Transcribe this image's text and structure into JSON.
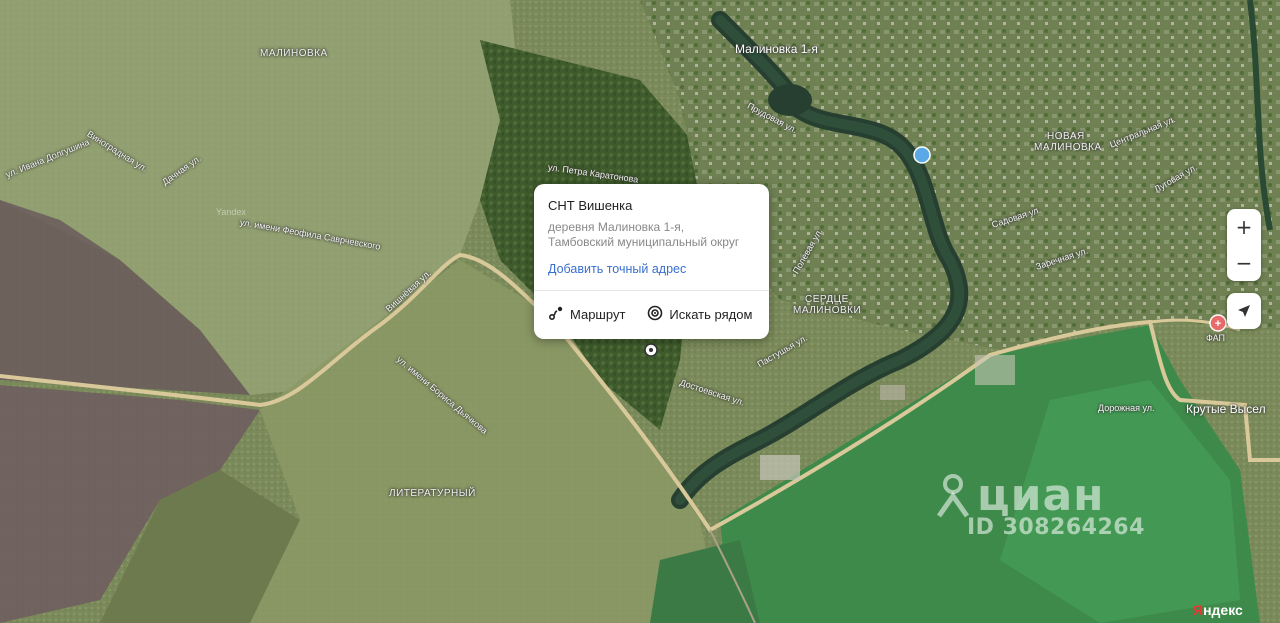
{
  "map": {
    "labels": {
      "malinovka": "МАЛИНОВКА",
      "malinovka_1": "Малиновка 1-я",
      "novaya_malinovka_1": "НОВАЯ",
      "novaya_malinovka_2": "МАЛИНОВКА",
      "serdtse_1": "СЕРДЦЕ",
      "serdtse_2": "МАЛИНОВКИ",
      "literaturny": "ЛИТЕРАТУРНЫЙ",
      "krutye": "Крутые Высел",
      "fap": "ФАП",
      "vinogradnaya": "Виноградная ул.",
      "vishnevaya": "Вишнёвая ул.",
      "petra_karatonova": "ул. Петра Каратонова",
      "ivana_dolgushina": "ул. Ивана Долгушина",
      "feofila_savrichevskogo": "ул. имени Феофила Саврчевского",
      "imeni_kimenko": "ул. имени Бориса Дьячкова",
      "dachnaya": "Дачная ул.",
      "dostoevskogo": "Достоевская ул.",
      "polevaya": "Полевая ул.",
      "pastushya": "Пастушья ул.",
      "dorozhnaya": "Дорожная ул.",
      "sadovaya": "Садовая ул.",
      "zarechnaya": "Заречная ул.",
      "prudovaya": "Прудовая ул.",
      "tsentralnaya": "Центральная ул.",
      "lugovaya": "Луговая ул.",
      "yandex_faint": "Yandex"
    }
  },
  "popup": {
    "title": "СНТ Вишенка",
    "address_line1": "деревня Малиновка 1-я,",
    "address_line2": "Тамбовский муниципальный округ",
    "add_address_link": "Добавить точный адрес",
    "route_label": "Маршрут",
    "search_nearby_label": "Искать рядом"
  },
  "controls": {
    "zoom_in": "+",
    "zoom_out": "−"
  },
  "watermark": {
    "brand": "циан",
    "id": "ID 308264264"
  },
  "logo": {
    "first_letter": "Я",
    "rest": "ндекс"
  },
  "colors": {
    "road": "#d9c99a",
    "river": "#2f4a3a",
    "link": "#3a6fcf"
  }
}
